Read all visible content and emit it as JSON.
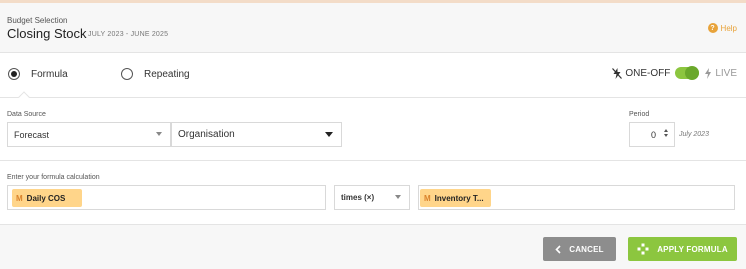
{
  "header": {
    "subtitle": "Budget Selection",
    "title": "Closing Stock",
    "date_range": "JULY 2023 - JUNE 2025",
    "help_label": "Help"
  },
  "mode": {
    "options": [
      {
        "label": "Formula",
        "selected": true
      },
      {
        "label": "Repeating",
        "selected": false
      }
    ],
    "toggle": {
      "off_label": "ONE-OFF",
      "on_label": "LIVE",
      "state": "on"
    }
  },
  "data_source": {
    "label": "Data Source",
    "source_value": "Forecast",
    "entity_value": "Organisation"
  },
  "period": {
    "label": "Period",
    "value": "0",
    "month": "July 2023"
  },
  "formula": {
    "label": "Enter your formula calculation",
    "left_chip": {
      "badge": "M",
      "text": "Daily COS"
    },
    "operator": "times (×)",
    "right_chip": {
      "badge": "M",
      "text": "Inventory T..."
    }
  },
  "footer": {
    "cancel_label": "CANCEL",
    "apply_label": "APPLY FORMULA"
  },
  "colors": {
    "accent_green": "#8cc63f",
    "help_orange": "#e8a33a",
    "chip_bg": "#ffd58a",
    "cancel_gray": "#8d8d8d"
  }
}
